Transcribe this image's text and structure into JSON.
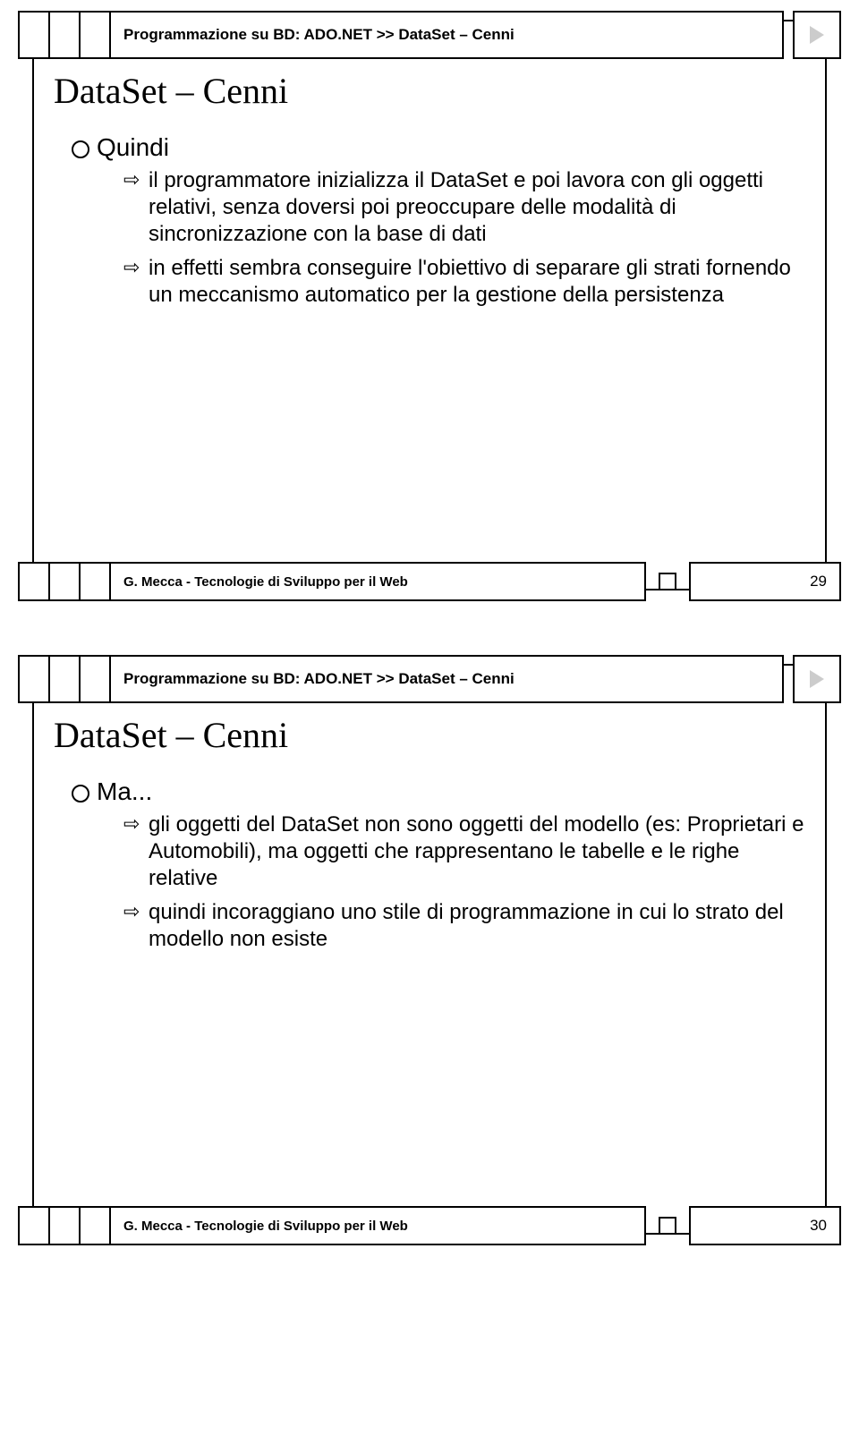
{
  "slide1": {
    "breadcrumb": "Programmazione su BD: ADO.NET >> DataSet – Cenni",
    "title": "DataSet – Cenni",
    "bullet": "Quindi",
    "sub1": "il programmatore inizializza il DataSet e poi lavora con gli oggetti relativi, senza doversi poi preoccupare delle modalità di sincronizzazione con la base di dati",
    "sub2": "in effetti sembra conseguire l'obiettivo di separare gli strati fornendo un meccanismo automatico per la gestione della persistenza",
    "footer": "G. Mecca - Tecnologie di Sviluppo per il Web",
    "page": "29"
  },
  "slide2": {
    "breadcrumb": "Programmazione su BD: ADO.NET >> DataSet – Cenni",
    "title": "DataSet – Cenni",
    "bullet": "Ma...",
    "sub1": "gli oggetti del DataSet non sono oggetti del modello (es: Proprietari e Automobili), ma oggetti che rappresentano le tabelle e le righe relative",
    "sub2": "quindi incoraggiano uno stile di programmazione in cui lo strato del modello non esiste",
    "footer": "G. Mecca - Tecnologie di Sviluppo per il Web",
    "page": "30"
  }
}
